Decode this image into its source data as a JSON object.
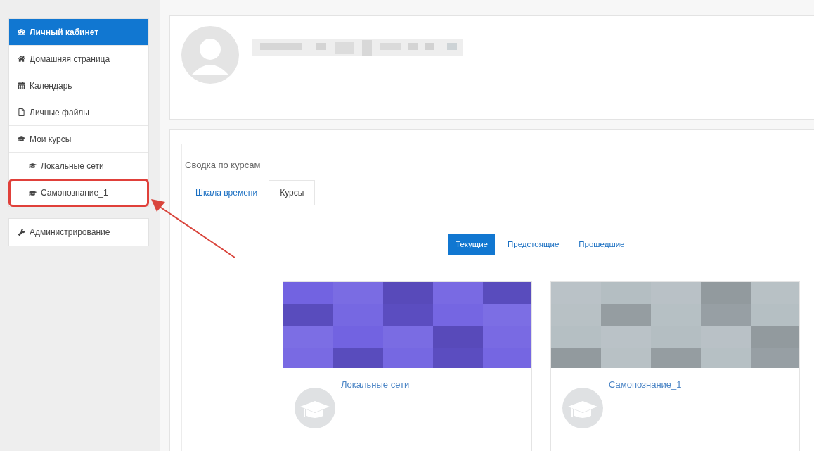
{
  "sidebar": {
    "groups": [
      {
        "items": [
          {
            "label": "Личный кабинет",
            "selected": true
          },
          {
            "label": "Домашняя страница",
            "selected": false
          },
          {
            "label": "Календарь",
            "selected": false
          },
          {
            "label": "Личные файлы",
            "selected": false
          },
          {
            "label": "Мои курсы",
            "selected": false,
            "children": [
              {
                "label": "Локальные сети",
                "selected": false
              },
              {
                "label": "Самопознание_1",
                "selected": false,
                "annotated": true
              }
            ]
          }
        ]
      },
      {
        "items": [
          {
            "label": "Администрирование",
            "selected": false
          }
        ]
      }
    ]
  },
  "course_overview": {
    "title": "Сводка по курсам",
    "tabs": [
      {
        "label": "Шкала времени",
        "selected": false
      },
      {
        "label": "Курсы",
        "selected": true
      }
    ],
    "filters": [
      {
        "label": "Текущие",
        "selected": true
      },
      {
        "label": "Предстоящие",
        "selected": false
      },
      {
        "label": "Прошедшие",
        "selected": false
      }
    ],
    "courses": [
      {
        "name": "Локальные сети",
        "color": "#6a5ae0"
      },
      {
        "name": "Самопознание_1",
        "color": "#b0babf"
      }
    ]
  }
}
